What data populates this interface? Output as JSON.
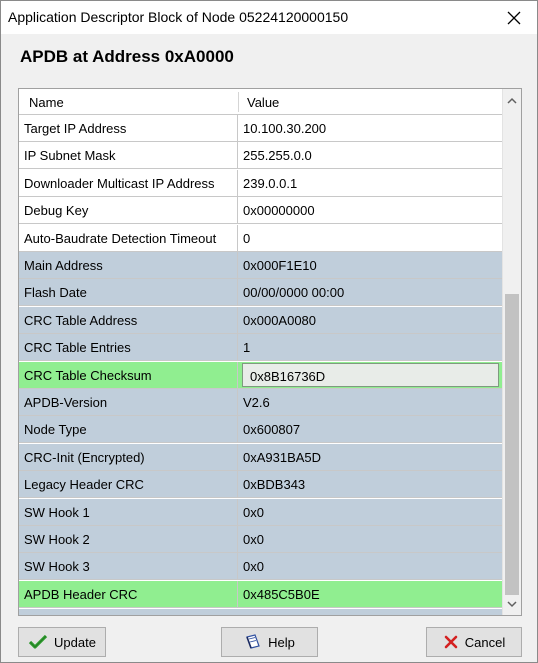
{
  "window": {
    "title": "Application Descriptor Block of Node 05224120000150",
    "close_icon": "close-icon"
  },
  "header": {
    "heading": "APDB at Address 0xA0000"
  },
  "grid": {
    "columns": {
      "name": "Name",
      "value": "Value"
    },
    "rows": [
      {
        "name": "Target IP Address",
        "value": "10.100.30.200",
        "style": "white"
      },
      {
        "name": "IP Subnet Mask",
        "value": "255.255.0.0",
        "style": "white"
      },
      {
        "name": "Downloader Multicast IP Address",
        "value": "239.0.0.1",
        "style": "white"
      },
      {
        "name": "Debug Key",
        "value": "0x00000000",
        "style": "white"
      },
      {
        "name": "Auto-Baudrate Detection Timeout",
        "value": "0",
        "style": "white"
      },
      {
        "name": "Main Address",
        "value": "0x000F1E10",
        "style": "blue"
      },
      {
        "name": "Flash Date",
        "value": "00/00/0000 00:00",
        "style": "blue"
      },
      {
        "name": "CRC Table Address",
        "value": "0x000A0080",
        "style": "blue"
      },
      {
        "name": "CRC Table Entries",
        "value": "1",
        "style": "blue"
      },
      {
        "name": "CRC Table Checksum",
        "value": "0x8B16736D",
        "style": "green",
        "selected": true
      },
      {
        "name": "APDB-Version",
        "value": "V2.6",
        "style": "blue"
      },
      {
        "name": "Node Type",
        "value": "0x600807",
        "style": "blue"
      },
      {
        "name": "CRC-Init (Encrypted)",
        "value": "0xA931BA5D",
        "style": "blue"
      },
      {
        "name": "Legacy Header CRC",
        "value": "0xBDB343",
        "style": "blue"
      },
      {
        "name": "SW Hook 1",
        "value": "0x0",
        "style": "blue"
      },
      {
        "name": "SW Hook 2",
        "value": "0x0",
        "style": "blue"
      },
      {
        "name": "SW Hook 3",
        "value": "0x0",
        "style": "blue"
      },
      {
        "name": "APDB Header CRC",
        "value": "0x485C5B0E",
        "style": "green"
      }
    ],
    "scroll": {
      "visible_fraction": 0.62,
      "position_fraction": 1.0
    }
  },
  "buttons": {
    "update": {
      "label": "Update",
      "icon": "checkmark-icon"
    },
    "help": {
      "label": "Help",
      "icon": "help-book-icon"
    },
    "cancel": {
      "label": "Cancel",
      "icon": "cancel-x-icon"
    }
  },
  "colors": {
    "row_white": "#ffffff",
    "row_blue": "#c0cedb",
    "row_green": "#90ee90",
    "check_green": "#2e9e2e",
    "cancel_red": "#d42020"
  }
}
